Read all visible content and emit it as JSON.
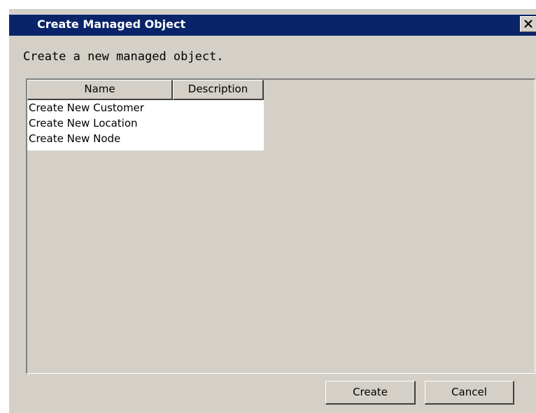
{
  "window": {
    "title": "Create Managed Object",
    "close_icon": "close-x-icon"
  },
  "message": "Create a new managed object.",
  "table": {
    "columns": [
      "Name",
      "Description"
    ],
    "rows": [
      {
        "name": "Create New Customer",
        "description": ""
      },
      {
        "name": "Create New Location",
        "description": ""
      },
      {
        "name": "Create New Node",
        "description": ""
      }
    ]
  },
  "buttons": {
    "create_label": "Create",
    "cancel_label": "Cancel"
  },
  "colors": {
    "titlebar": "#0a246a",
    "dialog_bg": "#d4d0c8",
    "title_text": "#ffffff"
  }
}
